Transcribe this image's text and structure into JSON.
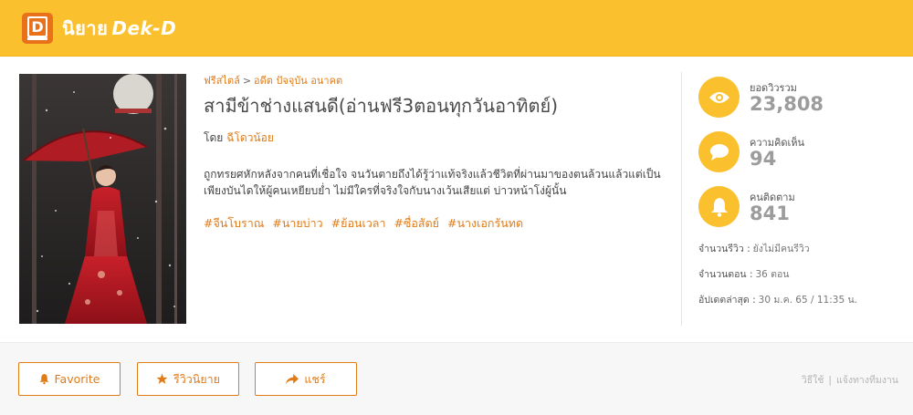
{
  "header": {
    "logo_icon": "dek-d-book-icon",
    "brand_thai": "นิยาย",
    "brand_name": "Dek-D",
    "brand_color": "#fbc02d"
  },
  "novel": {
    "breadcrumb": {
      "category": "ฟรีสไตล์",
      "separator": ">",
      "subcategory": "อดีต ปัจจุบัน อนาคต"
    },
    "title": "สามีข้าช่างแสนดี(อ่านฟรี3ตอนทุกวันอาทิตย์)",
    "author_prefix": "โดย",
    "author": "ฉีโดวน้อย",
    "description": "ถูกทรยศหักหลังจากคนที่เชื่อใจ จนวันตายถึงได้รู้ว่าแท้จริงแล้วชีวิตที่ผ่านมาของตนล้วนแล้วแต่เป็นเพียงบันไดให้ผู้คนเหยียบย่ำ ไม่มีใครที่จริงใจกับนางเว้นเสียแต่ บ่าวหน้าโง่ผู้นั้น",
    "tags": [
      "#จีนโบราณ",
      "#นายบ่าว",
      "#ย้อนเวลา",
      "#ซื่อสัตย์",
      "#นางเอกรันทด"
    ],
    "accent_color": "#e07b18"
  },
  "stats": {
    "views": {
      "label": "ยอดวิวรวม",
      "value": "23,808",
      "icon": "eye-icon"
    },
    "comments": {
      "label": "ความคิดเห็น",
      "value": "94",
      "icon": "speech-bubble-icon"
    },
    "followers": {
      "label": "คนติดตาม",
      "value": "841",
      "icon": "bell-icon"
    }
  },
  "meta": {
    "reviews_label": "จำนวนรีวิว :",
    "reviews_value": "ยังไม่มีคนรีวิว",
    "chapters_label": "จำนวนตอน :",
    "chapters_value": "36 ตอน",
    "updated_label": "อัปเดตล่าสุด :",
    "updated_value": "30 ม.ค. 65 / 11:35 น."
  },
  "actions": {
    "favorite_label": "Favorite",
    "review_label": "รีวิวนิยาย",
    "share_label": "แชร์"
  },
  "footer_links": {
    "howto": "วิธีใช้",
    "divider": "|",
    "report": "แจ้งทางทีมงาน"
  }
}
